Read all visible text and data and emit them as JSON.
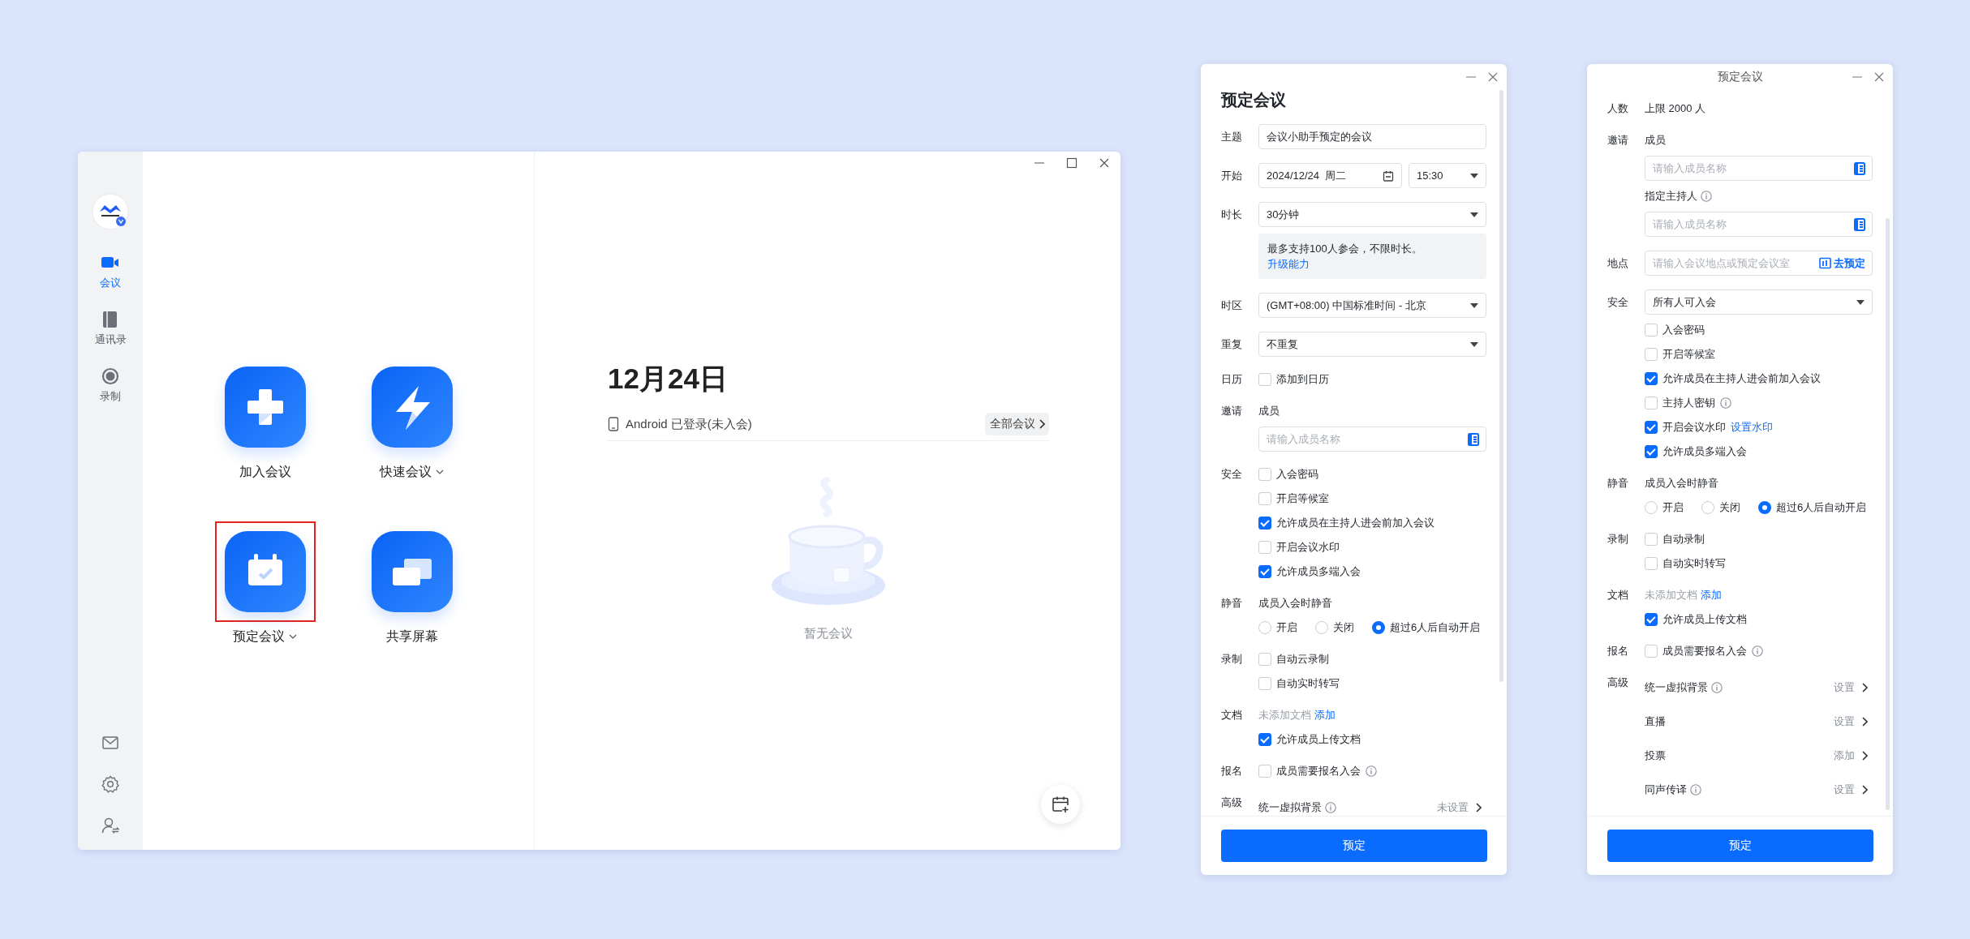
{
  "main_window": {
    "sidebar": {
      "items": [
        {
          "kind": "meetings",
          "label": "会议",
          "selected": true
        },
        {
          "kind": "contacts",
          "label": "通讯录",
          "selected": false
        },
        {
          "kind": "recordings",
          "label": "录制",
          "selected": false
        }
      ]
    },
    "actions": [
      {
        "kind": "join",
        "label": "加入会议"
      },
      {
        "kind": "quick",
        "label": "快速会议",
        "has_menu": true
      },
      {
        "kind": "schedule",
        "label": "预定会议",
        "has_menu": true,
        "highlighted": true
      },
      {
        "kind": "share",
        "label": "共享屏幕"
      }
    ],
    "date": "12月24日",
    "device_status": "Android 已登录(未入会)",
    "all_meetings_button": "全部会议",
    "empty_text": "暂无会议"
  },
  "panels": [
    {
      "heading": "预定会议",
      "sections": [
        {
          "label": "主题",
          "controls": [
            {
              "kind": "text_field",
              "value": "会议小助手预定的会议"
            }
          ]
        },
        {
          "label": "开始",
          "controls": [
            {
              "kind": "datetime",
              "date": "2024/12/24  周二",
              "time": "15:30"
            }
          ]
        },
        {
          "label": "时长",
          "controls": [
            {
              "kind": "select",
              "value": "30分钟"
            },
            {
              "kind": "note",
              "text": "最多支持100人参会，不限时长。",
              "link": "升级能力"
            }
          ]
        },
        {
          "label": "时区",
          "controls": [
            {
              "kind": "select",
              "value": "(GMT+08:00) 中国标准时间 - 北京"
            }
          ]
        },
        {
          "label": "重复",
          "controls": [
            {
              "kind": "select",
              "value": "不重复"
            }
          ]
        },
        {
          "label": "日历",
          "controls": [
            {
              "kind": "checkbox",
              "label": "添加到日历",
              "checked": false
            }
          ]
        },
        {
          "label": "邀请",
          "controls": [
            {
              "kind": "heading",
              "text": "成员"
            },
            {
              "kind": "member_field",
              "placeholder": "请输入成员名称"
            }
          ]
        },
        {
          "label": "安全",
          "controls": [
            {
              "kind": "checkbox",
              "label": "入会密码",
              "checked": false
            },
            {
              "kind": "checkbox",
              "label": "开启等候室",
              "checked": false
            },
            {
              "kind": "checkbox",
              "label": "允许成员在主持人进会前加入会议",
              "checked": true
            },
            {
              "kind": "checkbox",
              "label": "开启会议水印",
              "checked": false
            },
            {
              "kind": "checkbox",
              "label": "允许成员多端入会",
              "checked": true
            }
          ]
        },
        {
          "label": "静音",
          "controls": [
            {
              "kind": "heading",
              "text": "成员入会时静音"
            },
            {
              "kind": "radios",
              "options": [
                {
                  "label": "开启",
                  "selected": false
                },
                {
                  "label": "关闭",
                  "selected": false
                },
                {
                  "label": "超过6人后自动开启",
                  "selected": true
                }
              ]
            }
          ]
        },
        {
          "label": "录制",
          "controls": [
            {
              "kind": "checkbox",
              "label": "自动云录制",
              "checked": false
            },
            {
              "kind": "checkbox",
              "label": "自动实时转写",
              "checked": false
            }
          ]
        },
        {
          "label": "文档",
          "controls": [
            {
              "kind": "doc_status",
              "text": "未添加文档",
              "link": "添加"
            },
            {
              "kind": "checkbox",
              "label": "允许成员上传文档",
              "checked": true
            }
          ]
        },
        {
          "label": "报名",
          "controls": [
            {
              "kind": "checkbox",
              "label": "成员需要报名入会",
              "checked": false,
              "info": true
            }
          ]
        },
        {
          "label": "高级",
          "controls": [
            {
              "kind": "setting",
              "label": "统一虚拟背景",
              "info": true,
              "value": "未设置"
            }
          ]
        }
      ],
      "submit": "预定"
    },
    {
      "window_title": "预定会议",
      "sections": [
        {
          "label": "人数",
          "controls": [
            {
              "kind": "plain",
              "text": "上限 2000 人"
            }
          ]
        },
        {
          "label": "邀请",
          "controls": [
            {
              "kind": "heading",
              "text": "成员"
            },
            {
              "kind": "member_field",
              "placeholder": "请输入成员名称"
            },
            {
              "kind": "heading",
              "text": "指定主持人",
              "info": true
            },
            {
              "kind": "member_field",
              "placeholder": "请输入成员名称"
            }
          ]
        },
        {
          "label": "地点",
          "controls": [
            {
              "kind": "location_field",
              "placeholder": "请输入会议地点或预定会议室",
              "action": "去预定"
            }
          ]
        },
        {
          "label": "安全",
          "controls": [
            {
              "kind": "select",
              "value": "所有人可入会"
            },
            {
              "kind": "checkbox",
              "label": "入会密码",
              "checked": false
            },
            {
              "kind": "checkbox",
              "label": "开启等候室",
              "checked": false
            },
            {
              "kind": "checkbox",
              "label": "允许成员在主持人进会前加入会议",
              "checked": true
            },
            {
              "kind": "checkbox",
              "label": "主持人密钥",
              "checked": false,
              "info": true
            },
            {
              "kind": "checkbox",
              "label": "开启会议水印",
              "checked": true,
              "link": "设置水印"
            },
            {
              "kind": "checkbox",
              "label": "允许成员多端入会",
              "checked": true
            }
          ]
        },
        {
          "label": "静音",
          "controls": [
            {
              "kind": "heading",
              "text": "成员入会时静音"
            },
            {
              "kind": "radios",
              "options": [
                {
                  "label": "开启",
                  "selected": false
                },
                {
                  "label": "关闭",
                  "selected": false
                },
                {
                  "label": "超过6人后自动开启",
                  "selected": true
                }
              ]
            }
          ]
        },
        {
          "label": "录制",
          "controls": [
            {
              "kind": "checkbox",
              "label": "自动录制",
              "checked": false
            },
            {
              "kind": "checkbox",
              "label": "自动实时转写",
              "checked": false
            }
          ]
        },
        {
          "label": "文档",
          "controls": [
            {
              "kind": "doc_status",
              "text": "未添加文档",
              "link": "添加"
            },
            {
              "kind": "checkbox",
              "label": "允许成员上传文档",
              "checked": true
            }
          ]
        },
        {
          "label": "报名",
          "controls": [
            {
              "kind": "checkbox",
              "label": "成员需要报名入会",
              "checked": false,
              "info": true
            }
          ]
        },
        {
          "label": "高级",
          "controls": [
            {
              "kind": "setting",
              "label": "统一虚拟背景",
              "info": true,
              "value": "设置"
            },
            {
              "kind": "setting",
              "label": "直播",
              "value": "设置"
            },
            {
              "kind": "setting",
              "label": "投票",
              "value": "添加"
            },
            {
              "kind": "setting",
              "label": "同声传译",
              "info": true,
              "value": "设置"
            }
          ]
        }
      ],
      "submit": "预定"
    }
  ]
}
